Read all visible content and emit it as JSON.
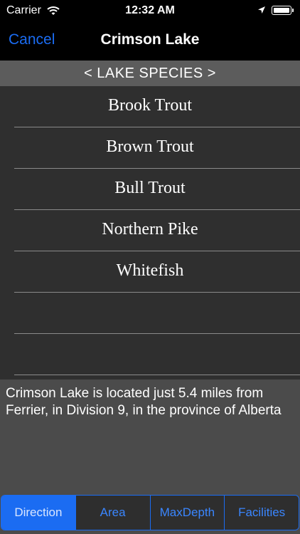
{
  "status_bar": {
    "carrier": "Carrier",
    "time": "12:32 AM"
  },
  "nav": {
    "cancel_label": "Cancel",
    "title": "Crimson Lake"
  },
  "section_header": "< LAKE SPECIES >",
  "species": [
    "Brook Trout",
    "Brown Trout",
    "Bull Trout",
    "Northern Pike",
    "Whitefish",
    "",
    ""
  ],
  "description": "Crimson Lake is located just 5.4 miles from Ferrier, in Division 9, in the province of Alberta",
  "tabs": [
    {
      "label": "Direction",
      "active": true
    },
    {
      "label": "Area",
      "active": false
    },
    {
      "label": "MaxDepth",
      "active": false
    },
    {
      "label": "Facilities",
      "active": false
    }
  ],
  "colors": {
    "accent": "#1b6cf2",
    "list_bg": "#2f2f2f",
    "header_bg": "#5c5c5c",
    "description_bg": "#4b4b4b"
  }
}
